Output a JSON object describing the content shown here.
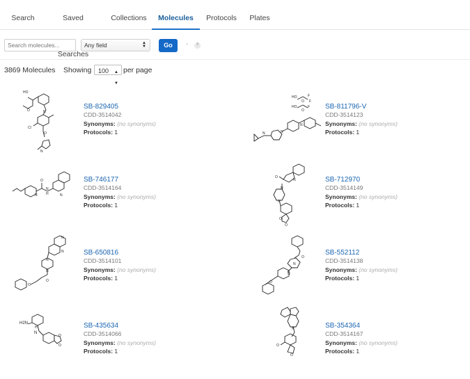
{
  "tabs": [
    {
      "label": "Search",
      "active": false
    },
    {
      "label": "Saved Searches",
      "active": false
    },
    {
      "label": "Collections",
      "active": false
    },
    {
      "label": "Molecules",
      "active": true
    },
    {
      "label": "Protocols",
      "active": false
    },
    {
      "label": "Plates",
      "active": false
    }
  ],
  "search": {
    "placeholder": "Search molecules...",
    "field_value": "Any field",
    "go_label": "Go",
    "dash": "-",
    "help": "?"
  },
  "summary": {
    "count_text": "3869 Molecules",
    "showing_label": "Showing",
    "per_page_value": "100",
    "per_page_suffix": "per page"
  },
  "molecules": [
    {
      "id": "SB-829405",
      "cdd": "CDD-3514042",
      "synonyms_label": "Synonyms:",
      "synonyms": "(no synonyms)",
      "protocols_label": "Protocols:",
      "protocols": "1",
      "atoms": [
        "HO",
        "O",
        "N",
        "Cl",
        "O",
        "N"
      ]
    },
    {
      "id": "SB-811796-V",
      "cdd": "CDD-3514123",
      "synonyms_label": "Synonyms:",
      "synonyms": "(no synonyms)",
      "protocols_label": "Protocols:",
      "protocols": "1",
      "atoms": [
        "HO",
        "O",
        "F",
        "F",
        "F",
        "HO",
        "O",
        "N",
        "N",
        "N"
      ]
    },
    {
      "id": "SB-746177",
      "cdd": "CDD-3514164",
      "synonyms_label": "Synonyms:",
      "synonyms": "(no synonyms)",
      "protocols_label": "Protocols:",
      "protocols": "1",
      "atoms": [
        "N",
        "O",
        "N",
        "H",
        "N"
      ]
    },
    {
      "id": "SB-712970",
      "cdd": "CDD-3514149",
      "synonyms_label": "Synonyms:",
      "synonyms": "(no synonyms)",
      "protocols_label": "Protocols:",
      "protocols": "1",
      "atoms": [
        "O",
        "N",
        "N",
        "N",
        "O",
        "O"
      ]
    },
    {
      "id": "SB-650816",
      "cdd": "CDD-3514101",
      "synonyms_label": "Synonyms:",
      "synonyms": "(no synonyms)",
      "protocols_label": "Protocols:",
      "protocols": "1",
      "atoms": [
        "N",
        "N",
        "N",
        "N",
        "O",
        "O"
      ]
    },
    {
      "id": "SB-552112",
      "cdd": "CDD-3514138",
      "synonyms_label": "Synonyms:",
      "synonyms": "(no synonyms)",
      "protocols_label": "Protocols:",
      "protocols": "1",
      "atoms": [
        "O",
        "N",
        "N",
        "O"
      ]
    },
    {
      "id": "SB-435634",
      "cdd": "CDD-3514066",
      "synonyms_label": "Synonyms:",
      "synonyms": "(no synonyms)",
      "protocols_label": "Protocols:",
      "protocols": "1",
      "atoms": [
        "H2N",
        "H",
        "N",
        "O",
        "O"
      ]
    },
    {
      "id": "SB-354364",
      "cdd": "CDD-3514167",
      "synonyms_label": "Synonyms:",
      "synonyms": "(no synonyms)",
      "protocols_label": "Protocols:",
      "protocols": "1",
      "atoms": [
        "N",
        "O",
        "O"
      ]
    }
  ],
  "colors": {
    "link": "#1a65b0",
    "accent": "#1569c7",
    "muted": "#777777"
  }
}
